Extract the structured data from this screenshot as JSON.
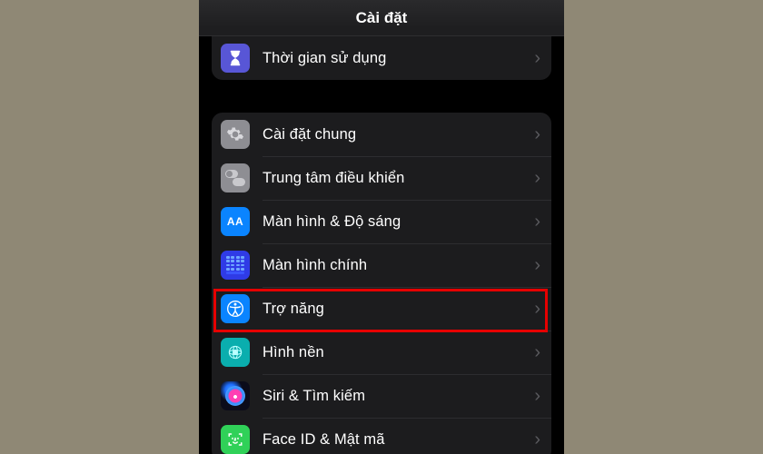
{
  "header": {
    "title": "Cài đặt"
  },
  "groups": [
    {
      "rows": [
        {
          "icon": "hourglass",
          "label": "Thời gian sử dụng"
        }
      ]
    },
    {
      "rows": [
        {
          "icon": "gear",
          "label": "Cài đặt chung"
        },
        {
          "icon": "control",
          "label": "Trung tâm điều khiển"
        },
        {
          "icon": "display",
          "label": "Màn hình & Độ sáng"
        },
        {
          "icon": "home",
          "label": "Màn hình chính"
        },
        {
          "icon": "accessibility",
          "label": "Trợ năng",
          "highlighted": true
        },
        {
          "icon": "wallpaper",
          "label": "Hình nền"
        },
        {
          "icon": "siri",
          "label": "Siri & Tìm kiếm"
        },
        {
          "icon": "faceid",
          "label": "Face ID & Mật mã"
        }
      ]
    }
  ],
  "icons": {
    "display_text": "AA"
  },
  "colors": {
    "highlight": "#e60000",
    "blue": "#0a84ff",
    "gray": "#8e8e93",
    "purple": "#5856d6",
    "teal": "#0aaeae",
    "green": "#30d158"
  }
}
